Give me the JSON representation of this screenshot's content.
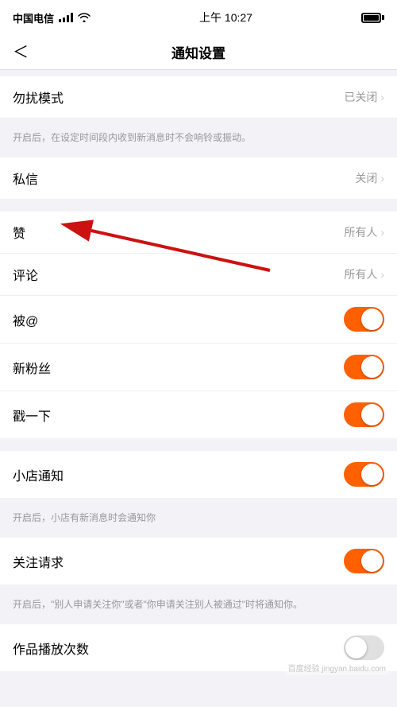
{
  "statusBar": {
    "carrier": "中国电信",
    "time": "上午 10:27",
    "wifiIcon": "wifi",
    "batteryFull": true
  },
  "navBar": {
    "backLabel": "‹",
    "title": "通知设置"
  },
  "sections": [
    {
      "id": "dnd",
      "rows": [
        {
          "id": "dnd-mode",
          "label": "勿扰模式",
          "value": "已关闭",
          "type": "link",
          "showChevron": true
        }
      ],
      "description": "开启后，在设定时间段内收到新消息时不会响铃或振动。"
    },
    {
      "id": "private",
      "rows": [
        {
          "id": "private-message",
          "label": "私信",
          "value": "关闭",
          "type": "link",
          "showChevron": true
        }
      ],
      "description": null
    },
    {
      "id": "interactions",
      "rows": [
        {
          "id": "likes",
          "label": "赞",
          "value": "所有人",
          "type": "link",
          "showChevron": true
        },
        {
          "id": "comments",
          "label": "评论",
          "value": "所有人",
          "type": "link",
          "showChevron": true
        },
        {
          "id": "mentioned",
          "label": "被@",
          "value": null,
          "type": "toggle",
          "toggleOn": true
        },
        {
          "id": "new-fans",
          "label": "新粉丝",
          "value": null,
          "type": "toggle",
          "toggleOn": true
        },
        {
          "id": "slash",
          "label": "戳一下",
          "value": null,
          "type": "toggle",
          "toggleOn": true
        }
      ],
      "description": null
    },
    {
      "id": "shop",
      "rows": [
        {
          "id": "shop-notify",
          "label": "小店通知",
          "value": null,
          "type": "toggle",
          "toggleOn": true
        }
      ],
      "description": "开启后，小店有新消息时会通知你"
    },
    {
      "id": "follow",
      "rows": [
        {
          "id": "follow-request",
          "label": "关注请求",
          "value": null,
          "type": "toggle",
          "toggleOn": true
        }
      ],
      "description": "开启后，\"别人申请关注你\"或者\"你申请关注别人被通过\"时将通知你。"
    },
    {
      "id": "works",
      "rows": [
        {
          "id": "play-count",
          "label": "作品播放次数",
          "value": null,
          "type": "toggle",
          "toggleOn": false
        }
      ],
      "description": null
    }
  ],
  "watermark": "百度经验 jingyan.baidu.com"
}
